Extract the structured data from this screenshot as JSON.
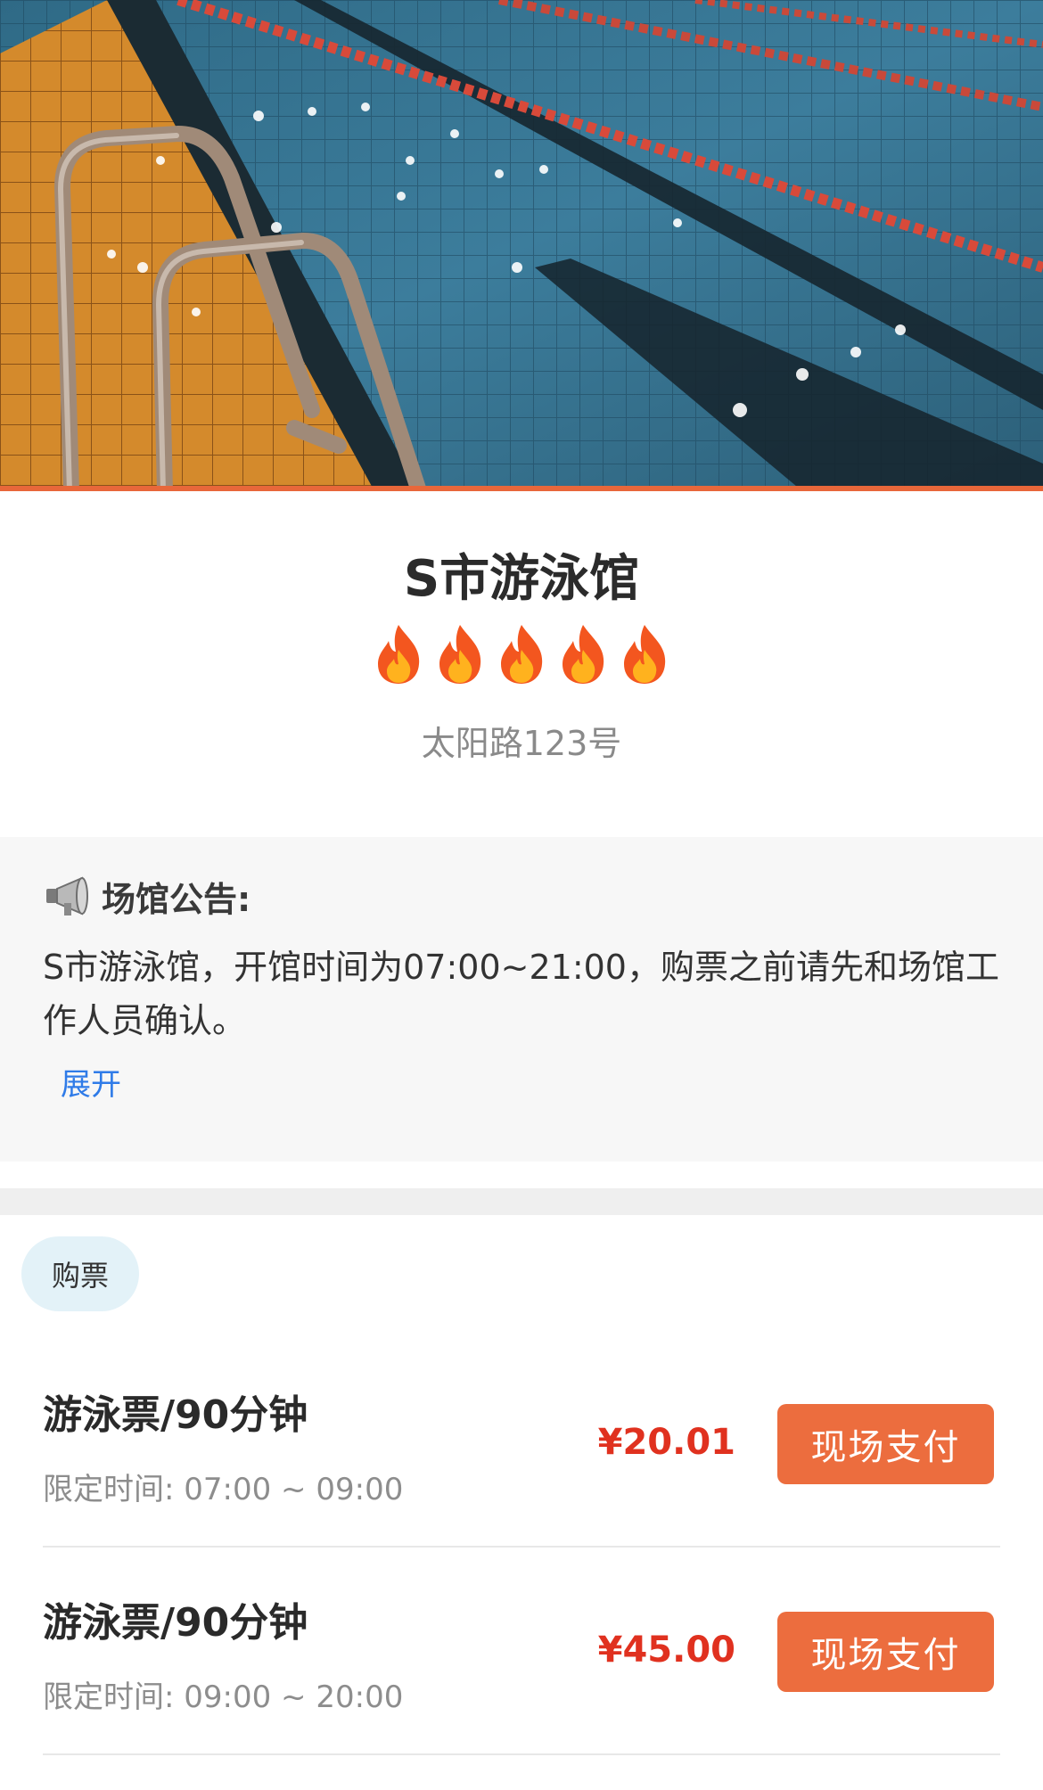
{
  "hero": {
    "image": "swimming-pool-photo"
  },
  "venue": {
    "name": "S市游泳馆",
    "rating_icons": [
      "fire-icon",
      "fire-icon",
      "fire-icon",
      "fire-icon",
      "fire-icon"
    ],
    "rating_value": 5,
    "address": "太阳路123号"
  },
  "notice": {
    "icon": "megaphone-icon",
    "title": "场馆公告:",
    "body": "S市游泳馆，开馆时间为07:00~21:00，购票之前请先和场馆工作人员确认。",
    "expand_label": "展开"
  },
  "tabs": {
    "active": "购票"
  },
  "tickets": [
    {
      "name": "游泳票/90分钟",
      "time": "限定时间: 07:00 ~ 09:00",
      "price": "¥20.01",
      "button": "现场支付"
    },
    {
      "name": "游泳票/90分钟",
      "time": "限定时间: 09:00 ~ 20:00",
      "price": "¥45.00",
      "button": "现场支付"
    }
  ],
  "colors": {
    "accent": "#ec6d3e",
    "price": "#e0311f",
    "link": "#2f7be8",
    "tab_bg": "#e3f2f8"
  }
}
